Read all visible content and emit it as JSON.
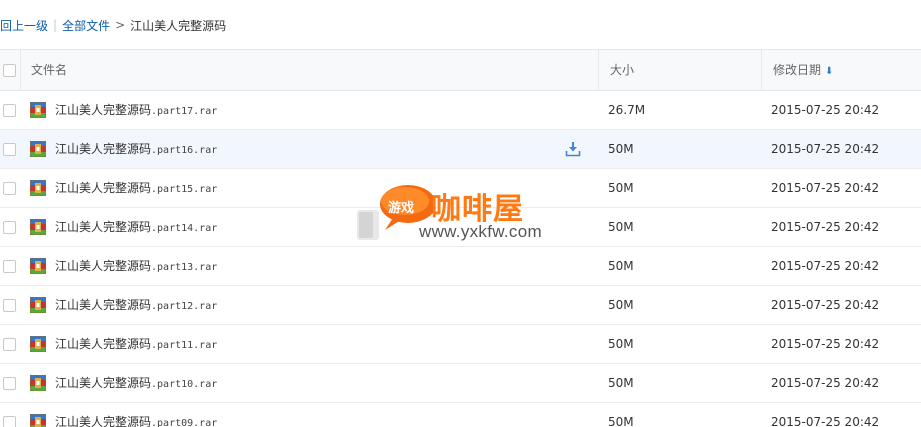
{
  "breadcrumb": {
    "back": "回上一级",
    "separator": "|",
    "all_files": "全部文件",
    "arrow": ">",
    "current": "江山美人完整源码"
  },
  "header": {
    "name": "文件名",
    "size": "大小",
    "date": "修改日期",
    "sort_indicator": "sort-desc-arrow-icon"
  },
  "files": [
    {
      "base": "江山美人完整源码",
      "ext": ".part17.rar",
      "size": "26.7M",
      "date": "2015-07-25 20:42"
    },
    {
      "base": "江山美人完整源码",
      "ext": ".part16.rar",
      "size": "50M",
      "date": "2015-07-25 20:42"
    },
    {
      "base": "江山美人完整源码",
      "ext": ".part15.rar",
      "size": "50M",
      "date": "2015-07-25 20:42"
    },
    {
      "base": "江山美人完整源码",
      "ext": ".part14.rar",
      "size": "50M",
      "date": "2015-07-25 20:42"
    },
    {
      "base": "江山美人完整源码",
      "ext": ".part13.rar",
      "size": "50M",
      "date": "2015-07-25 20:42"
    },
    {
      "base": "江山美人完整源码",
      "ext": ".part12.rar",
      "size": "50M",
      "date": "2015-07-25 20:42"
    },
    {
      "base": "江山美人完整源码",
      "ext": ".part11.rar",
      "size": "50M",
      "date": "2015-07-25 20:42"
    },
    {
      "base": "江山美人完整源码",
      "ext": ".part10.rar",
      "size": "50M",
      "date": "2015-07-25 20:42"
    },
    {
      "base": "江山美人完整源码",
      "ext": ".part09.rar",
      "size": "50M",
      "date": "2015-07-25 20:42"
    }
  ],
  "hover_row_index": 1,
  "watermark": {
    "bubble_text": "游戏",
    "logo_text": "咖啡屋",
    "url": "www.yxkfw.com"
  },
  "colors": {
    "link": "#0b5fa5",
    "accent": "#2f7ccf",
    "hover_row": "#f2f7fd",
    "watermark_orange": "#ff7a12"
  },
  "icons": {
    "file": "rar-archive-icon",
    "download": "download-icon"
  }
}
